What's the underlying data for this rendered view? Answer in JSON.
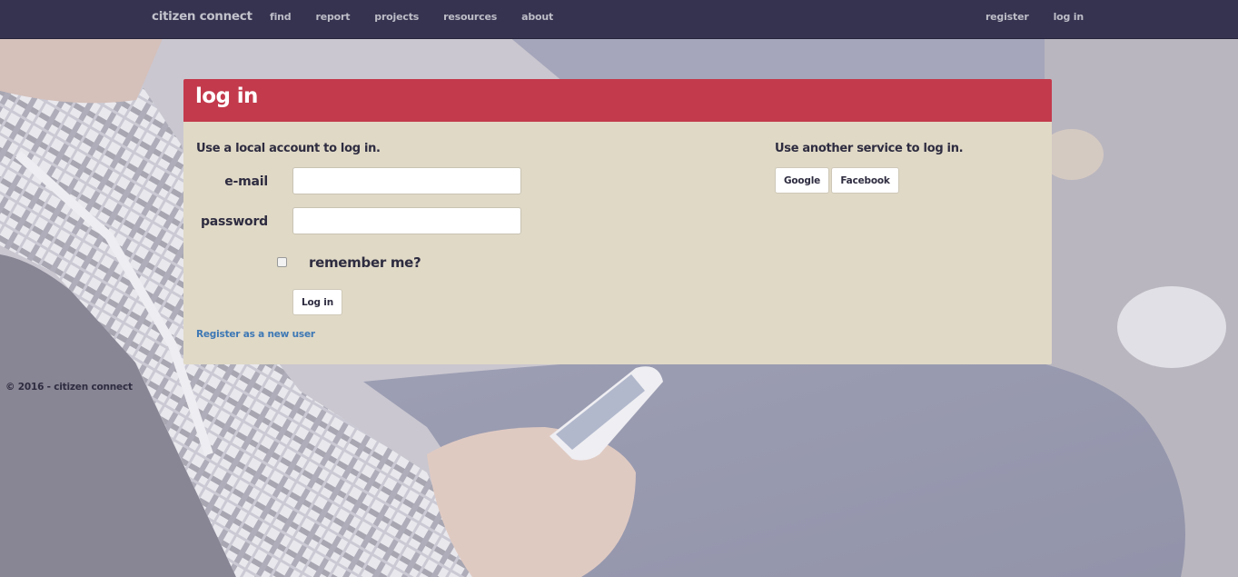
{
  "nav": {
    "brand": "citizen connect",
    "left_links": [
      "find",
      "report",
      "projects",
      "resources",
      "about"
    ],
    "right_links": [
      "register",
      "log in"
    ]
  },
  "panel": {
    "title": "log in",
    "local": {
      "heading": "Use a local account to log in.",
      "email_label": "e-mail",
      "email_value": "",
      "password_label": "password",
      "password_value": "",
      "remember_label": "remember me?",
      "remember_checked": false,
      "submit_label": "Log in",
      "register_link": "Register as a new user"
    },
    "external": {
      "heading": "Use another service to log in.",
      "providers": [
        "Google",
        "Facebook"
      ]
    }
  },
  "footer": {
    "text": "© 2016 - citizen connect"
  },
  "colors": {
    "navbar": "#35334f",
    "panel_header": "#c33a4c",
    "panel_body": "#e0d9c6",
    "link": "#3d78b5",
    "text": "#2e2c40"
  }
}
